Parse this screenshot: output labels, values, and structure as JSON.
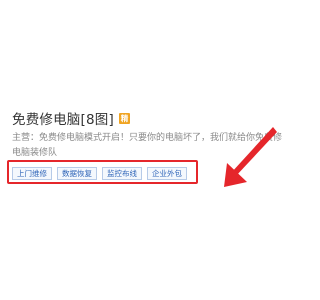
{
  "listing": {
    "title": "免费修电脑[8图]",
    "badge_label": "精",
    "description": "主营：免费修电脑模式开启！只要你的电脑坏了，我们就给你免费修电脑装修队",
    "tags": [
      "上门维修",
      "数据恢复",
      "监控布线",
      "企业外包"
    ]
  },
  "colors": {
    "highlight_box": "#e5262b",
    "arrow": "#e5262b",
    "tag_text": "#2e64b8",
    "badge": "#f0a422"
  }
}
